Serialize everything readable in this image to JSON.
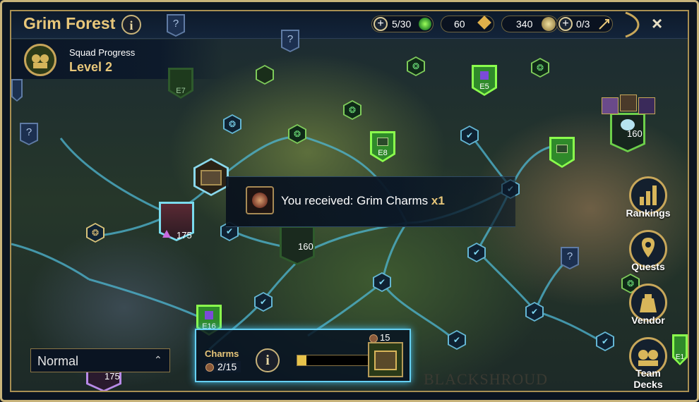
{
  "header": {
    "title": "Grim Forest",
    "resources": [
      {
        "name": "energy",
        "value": "5/30",
        "icon": "green-gem-icon",
        "has_plus": true
      },
      {
        "name": "gems",
        "value": "60",
        "icon": "gold-diamond-icon",
        "has_plus": false
      },
      {
        "name": "silver",
        "value": "340",
        "icon": "silver-coin-icon",
        "has_plus": false
      },
      {
        "name": "keys",
        "value": "0/3",
        "icon": "arrow-key-icon",
        "has_plus": true
      }
    ],
    "close_icon": "×"
  },
  "squad": {
    "label": "Squad Progress",
    "level": "Level 2"
  },
  "map_nodes": {
    "banners": [
      "E7",
      "E5",
      "E8",
      "E16",
      "E1"
    ],
    "boss_levels": [
      "175",
      "160",
      "160",
      "175"
    ],
    "question_mark": "?"
  },
  "toast": {
    "text": "You received: Grim Charms",
    "quantity": "x1"
  },
  "side_menu": {
    "rankings": "Rankings",
    "quests": "Quests",
    "vendor": "Vendor",
    "team_decks": "Team Decks"
  },
  "mode_select": {
    "value": "Normal",
    "chevron": "⌃"
  },
  "charms": {
    "title": "Charms",
    "count": "2/15",
    "progress": 0.13,
    "reward_cost": "15"
  },
  "region": {
    "label": "BLACKSHROUD"
  },
  "colors": {
    "gold": "#e8c77a",
    "cyan": "#66d0f2",
    "green": "#8bff4d"
  }
}
